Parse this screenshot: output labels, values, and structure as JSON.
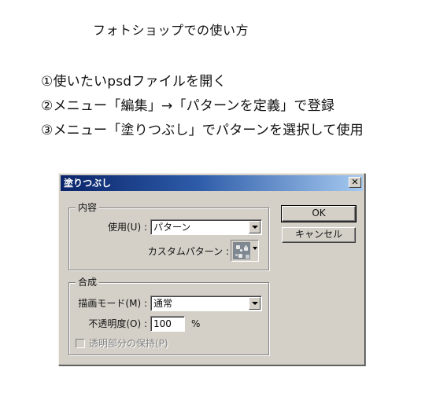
{
  "document": {
    "title": "フォトショップでの使い方",
    "steps": [
      "①使いたいpsdファイルを開く",
      "②メニュー「編集」→「パターンを定義」で登録",
      "③メニュー「塗りつぶし」でパターンを選択して使用"
    ]
  },
  "dialog": {
    "title": "塗りつぶし",
    "close_glyph": "✕",
    "contents": {
      "group_label": "内容",
      "use_label": "使用(U) :",
      "use_value": "パターン",
      "custom_pattern_label": "カスタムパターン :"
    },
    "blending": {
      "group_label": "合成",
      "mode_label": "描画モード(M) :",
      "mode_value": "通常",
      "opacity_label": "不透明度(O) :",
      "opacity_value": "100",
      "opacity_unit": "%",
      "preserve_transparency_label": "透明部分の保持(P)",
      "preserve_transparency_checked": false,
      "preserve_transparency_enabled": false
    },
    "buttons": {
      "ok": "OK",
      "cancel": "キャンセル"
    },
    "colors": {
      "face": "#d4d0c8",
      "titlebar_start": "#0a246a",
      "titlebar_end": "#a6caf0"
    }
  }
}
